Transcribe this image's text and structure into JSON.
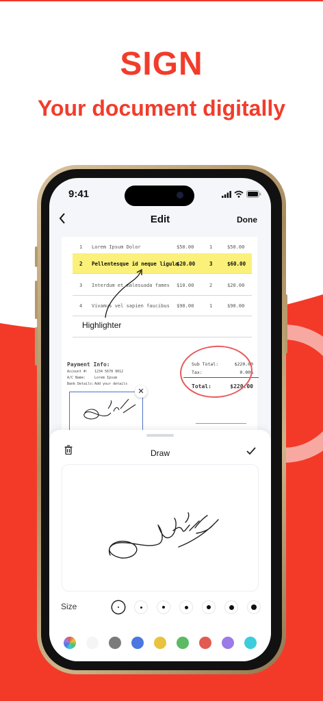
{
  "headline": "SIGN",
  "subheadline": "Your document digitally",
  "status_bar": {
    "time": "9:41"
  },
  "nav": {
    "back_icon": "chevron-left-icon",
    "title": "Edit",
    "done_label": "Done"
  },
  "document": {
    "rows": [
      {
        "num": "1",
        "desc": "Lorem Ipsum Dolor",
        "price": "$50.00",
        "qty": "1",
        "total": "$50.00",
        "highlighted": false
      },
      {
        "num": "2",
        "desc": "Pellentesque id neque ligula",
        "price": "$20.00",
        "qty": "3",
        "total": "$60.00",
        "highlighted": true
      },
      {
        "num": "3",
        "desc": "Interdum et malesuada fames",
        "price": "$10.00",
        "qty": "2",
        "total": "$20.00",
        "highlighted": false
      },
      {
        "num": "4",
        "desc": "Vivamus vel sapien faucibus",
        "price": "$90.00",
        "qty": "1",
        "total": "$90.00",
        "highlighted": false
      }
    ],
    "annotation_label": "Highlighter",
    "payment": {
      "heading": "Payment Info:",
      "lines": [
        {
          "k": "Account #:",
          "v": "1234 5678 9012"
        },
        {
          "k": "A/C Name:",
          "v": "Lorem Ipsum"
        },
        {
          "k": "Bank Details:",
          "v": "Add your details"
        }
      ]
    },
    "totals": {
      "subtotal_label": "Sub Total:",
      "subtotal": "$220.00",
      "tax_label": "Tax:",
      "tax": "0.00%",
      "total_label": "Total:",
      "total": "$220.00"
    },
    "close_icon": "close-icon"
  },
  "sheet": {
    "title": "Draw",
    "trash_icon": "trash-icon",
    "confirm_icon": "checkmark-icon",
    "size_label": "Size",
    "sizes": [
      2,
      3,
      4,
      5,
      6,
      7,
      8
    ],
    "selected_size_index": 0,
    "colors": [
      "#rainbow",
      "#f5f5f5",
      "#7b7b7b",
      "#4a77e0",
      "#e9c33e",
      "#5bba62",
      "#e15b50",
      "#9b7be6",
      "#3bcddc"
    ]
  },
  "theme": {
    "accent": "#f23c2b",
    "highlight": "#fbf17a",
    "circle": "#e85a5a",
    "selection": "#4a73c7"
  }
}
